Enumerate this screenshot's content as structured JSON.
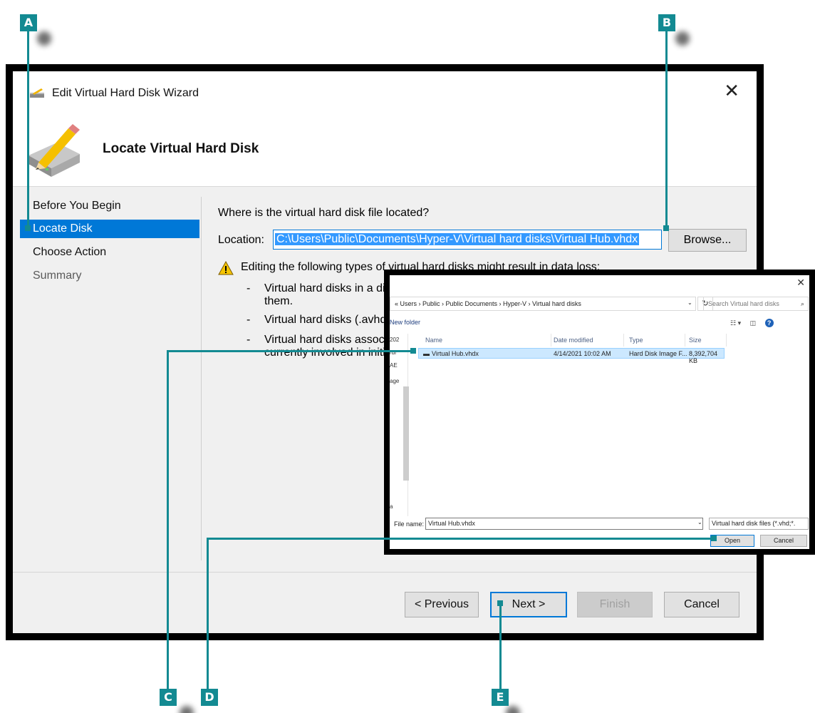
{
  "wizard": {
    "title": "Edit Virtual Hard Disk Wizard",
    "page_title": "Locate Virtual Hard Disk",
    "nav": [
      {
        "label": "Before You Begin",
        "state": "normal"
      },
      {
        "label": "Locate Disk",
        "state": "active"
      },
      {
        "label": "Choose Action",
        "state": "normal"
      },
      {
        "label": "Summary",
        "state": "disabled"
      }
    ],
    "question": "Where is the virtual hard disk file located?",
    "location_label": "Location:",
    "location_value": "C:\\Users\\Public\\Documents\\Hyper-V\\Virtual hard disks\\Virtual Hub.vhdx",
    "browse_label": "Browse...",
    "warning": "Editing the following types of virtual hard disks might result in data loss:",
    "bullets": [
      {
        "dash": "-",
        "text": "Virtual hard disks in a diffe them."
      },
      {
        "dash": "-",
        "text": "Virtual hard disks (.avhd/."
      },
      {
        "dash": "-",
        "text": "Virtual hard disks associat currently involved in initia"
      }
    ],
    "buttons": {
      "previous": "< Previous",
      "next": "Next >",
      "finish": "Finish",
      "cancel": "Cancel"
    },
    "accent_color": "#0078d7"
  },
  "file_dialog": {
    "breadcrumb": "« Users › Public › Public Documents › Hyper-V › Virtual hard disks",
    "search_placeholder": "Search Virtual hard disks",
    "new_folder": "New folder",
    "side_labels": [
      "202",
      "rdi",
      "AE",
      "age",
      "a"
    ],
    "columns": [
      "Name",
      "Date modified",
      "Type",
      "Size"
    ],
    "files": [
      {
        "name": "Virtual Hub.vhdx",
        "date": "4/14/2021 10:02 AM",
        "type": "Hard Disk Image F...",
        "size": "8,392,704 KB"
      }
    ],
    "file_name_label": "File name:",
    "file_name_value": "Virtual Hub.vhdx",
    "filter": "Virtual hard disk files  (*.vhd;*.",
    "open_label": "Open",
    "cancel_label": "Cancel"
  },
  "callouts": {
    "a": "A",
    "b": "B",
    "c": "C",
    "d": "D",
    "e": "E",
    "color": "#138a92"
  }
}
